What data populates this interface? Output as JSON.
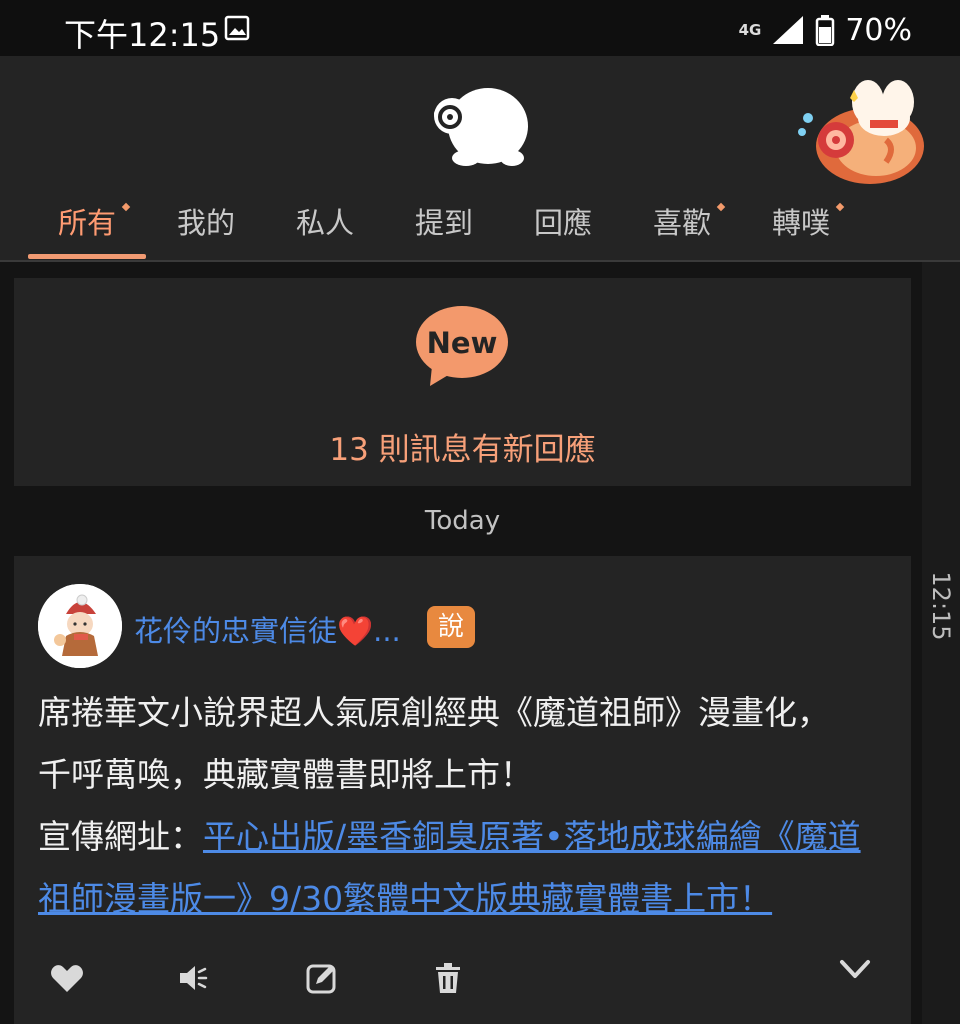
{
  "status_bar": {
    "time": "下午12:15",
    "network": "4G",
    "battery": "70%"
  },
  "tabs": [
    {
      "label": "所有",
      "active": true,
      "has_dot": true
    },
    {
      "label": "我的",
      "active": false,
      "has_dot": false
    },
    {
      "label": "私人",
      "active": false,
      "has_dot": false
    },
    {
      "label": "提到",
      "active": false,
      "has_dot": false
    },
    {
      "label": "回應",
      "active": false,
      "has_dot": false
    },
    {
      "label": "喜歡",
      "active": false,
      "has_dot": true
    },
    {
      "label": "轉噗",
      "active": false,
      "has_dot": true
    }
  ],
  "new_notice": {
    "badge": "New",
    "text": "13 則訊息有新回應"
  },
  "date_divider": "Today",
  "side_timeline_time": "12:15",
  "post": {
    "author": "花伶的忠實信徒❤️...",
    "qualifier": "說",
    "content_line1": "席捲華文小說界超人氣原創經典《魔道祖師》漫畫化，",
    "content_line2": "千呼萬喚，典藏實體書即將上市！",
    "link_prefix": "宣傳網址：",
    "link_text": "平心出版/墨香銅臭原著•落地成球編繪《魔道祖師漫畫版一》9/30繁體中文版典藏實體書上市！"
  },
  "actions": [
    "heart-icon",
    "mute-icon",
    "edit-icon",
    "trash-icon",
    "chevron-down-icon"
  ],
  "colors": {
    "accent": "#f19a72",
    "link": "#4d8ae6",
    "badge": "#e8893f",
    "card_bg": "#242424",
    "page_bg": "#141414"
  }
}
